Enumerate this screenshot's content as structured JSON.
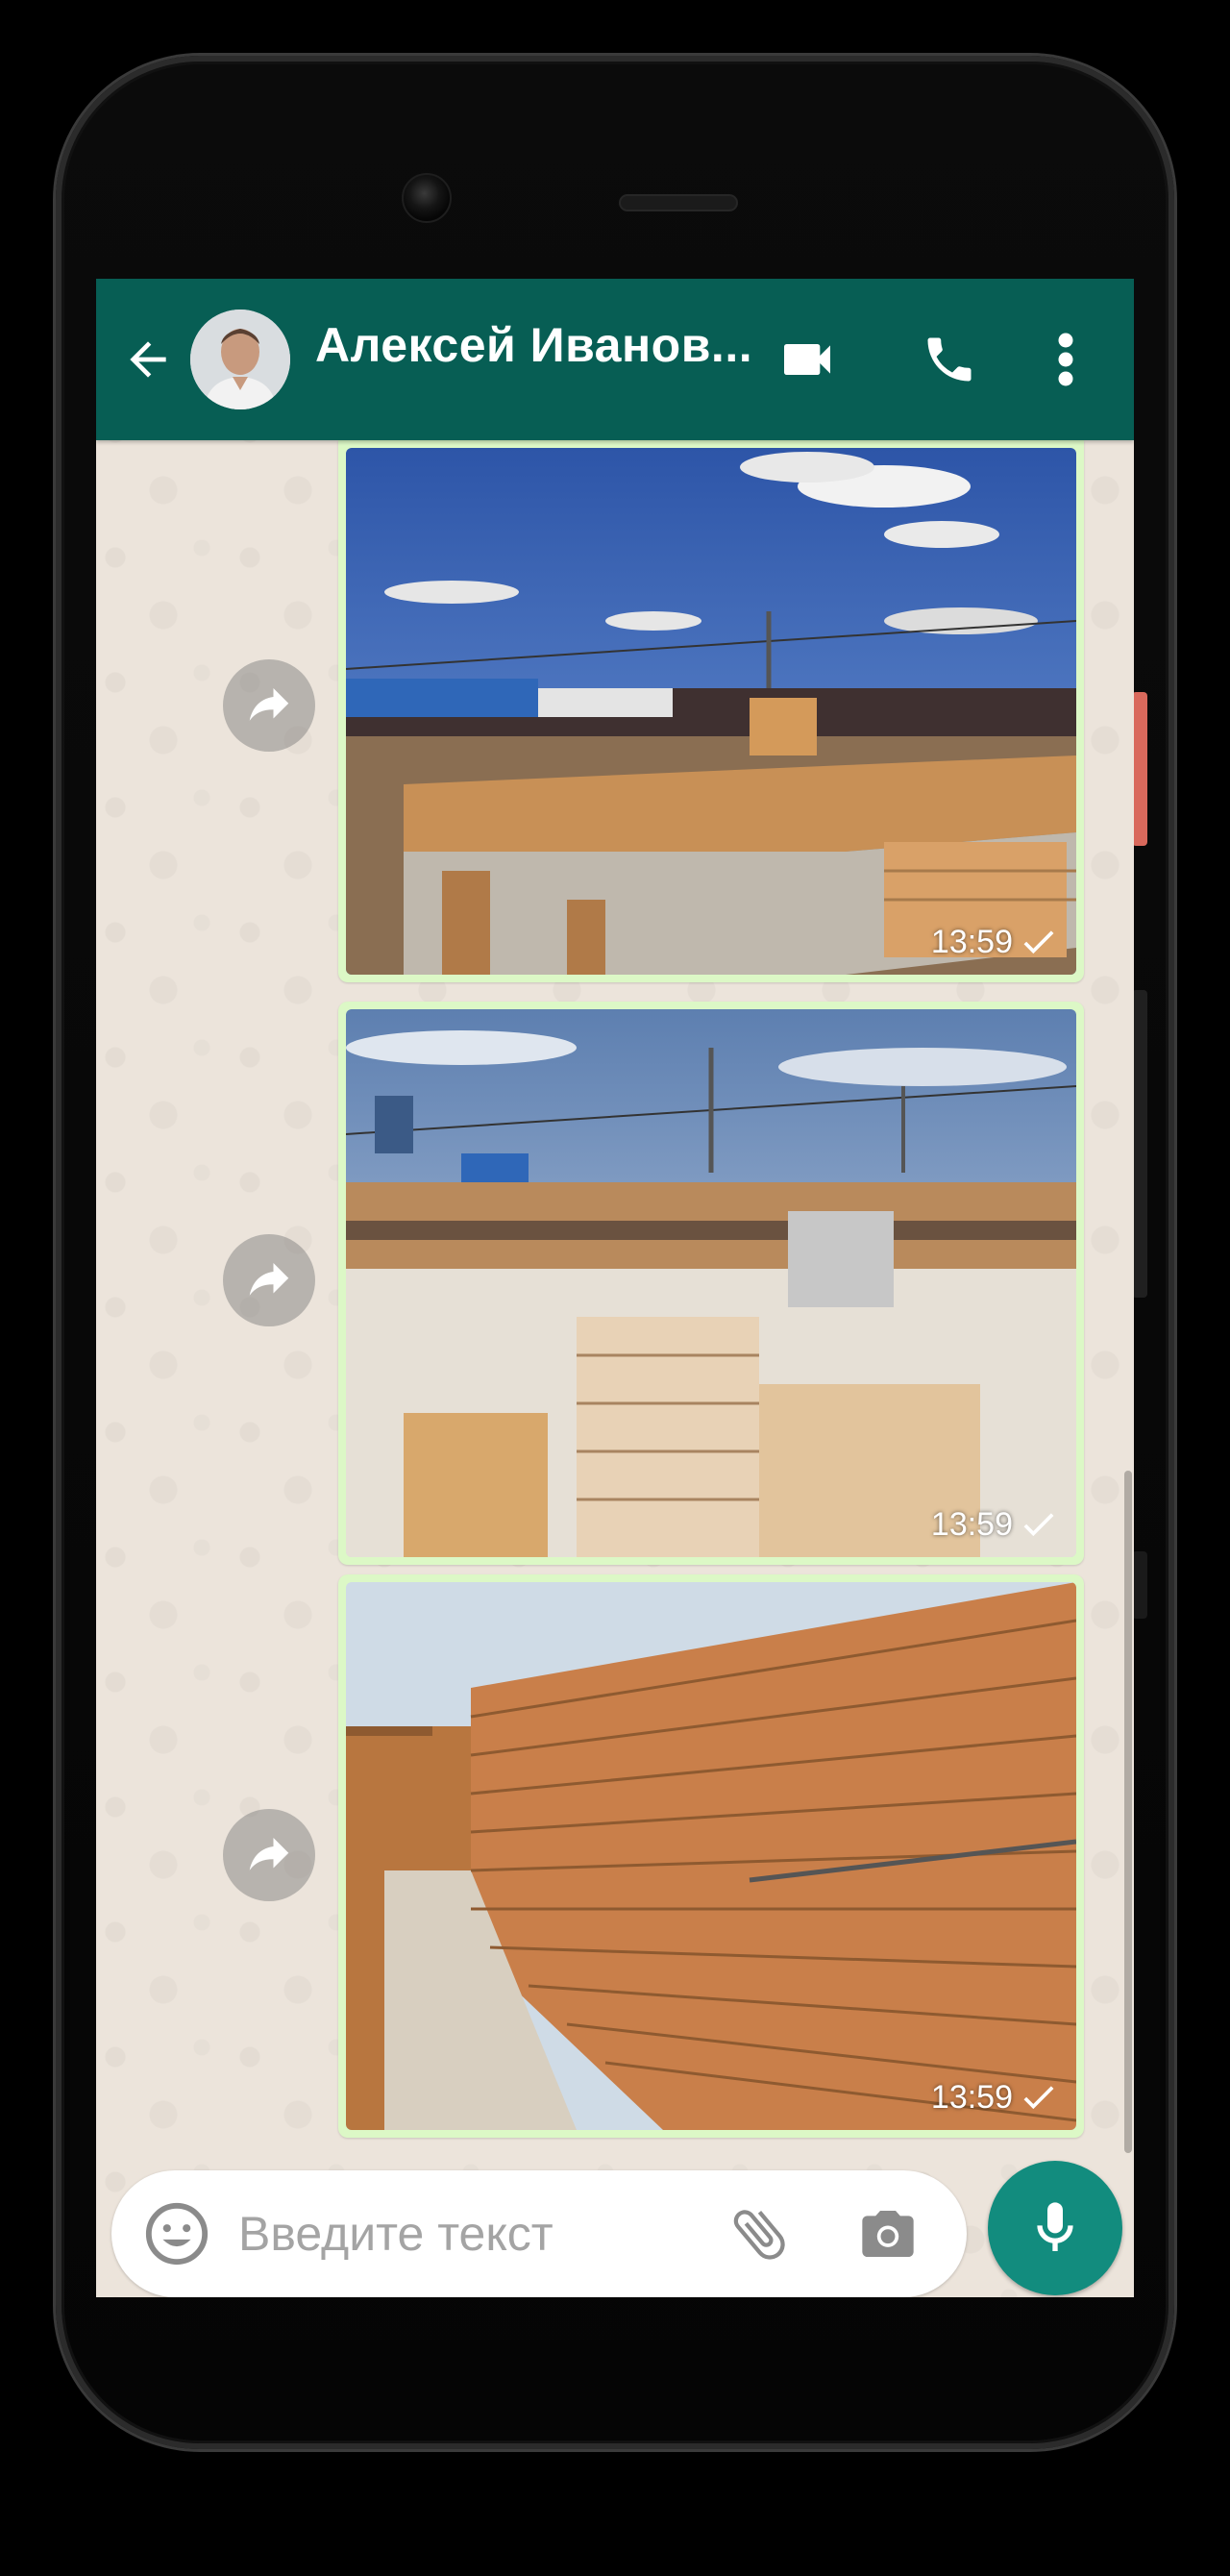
{
  "header": {
    "contact_name": "Алексей Иванов...",
    "icons": {
      "back": "arrow-left-icon",
      "video": "video-camera-icon",
      "call": "phone-icon",
      "menu": "more-vertical-icon"
    },
    "color": "#075e54"
  },
  "messages": [
    {
      "type": "photo",
      "subject": "brick foundation walls under blue sky",
      "time": "13:59",
      "status": "sent"
    },
    {
      "type": "photo",
      "subject": "pallets of bricks on construction site",
      "time": "13:59",
      "status": "sent"
    },
    {
      "type": "photo",
      "subject": "tall brick wall close-up",
      "time": "13:59",
      "status": "sent"
    }
  ],
  "composer": {
    "placeholder": "Введите текст",
    "value": "",
    "icons": [
      "emoji-icon",
      "paperclip-icon",
      "camera-icon",
      "microphone-icon"
    ]
  },
  "colors": {
    "toolbar": "#075e54",
    "outgoing_bubble": "#dcf8c6",
    "mic_button": "#128c7e"
  }
}
